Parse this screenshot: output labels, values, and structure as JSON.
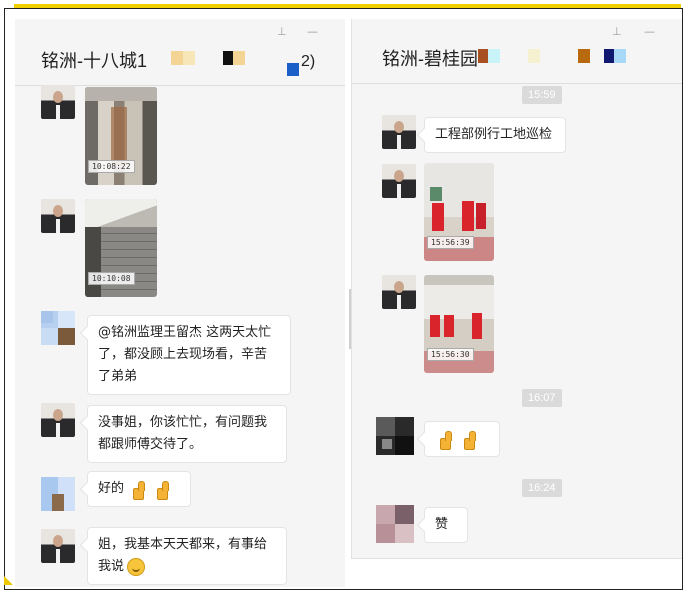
{
  "left_chat": {
    "title": "铭洲-十八城1",
    "title_tail": "2)",
    "messages": [
      {
        "type": "image",
        "timestamp": "10:08:22"
      },
      {
        "type": "image",
        "timestamp": "10:10:08"
      },
      {
        "type": "text",
        "line1": "@铭洲监理王留杰 这两天太忙",
        "line2": "了，都没顾上去现场看，辛苦",
        "line3": "了弟弟"
      },
      {
        "type": "text",
        "line1": "没事姐，你该忙忙，有问题我",
        "line2": "都跟师傅交待了。"
      },
      {
        "type": "text",
        "text": "好的",
        "emoji": [
          "thumbs-up",
          "thumbs-up"
        ]
      },
      {
        "type": "text",
        "line1": "姐，我基本天天都来，有事给",
        "line2": "我说",
        "emoji": "smile"
      }
    ]
  },
  "right_chat": {
    "title": "铭洲-碧桂园",
    "times": [
      "15:59",
      "16:07",
      "16:24"
    ],
    "messages": [
      {
        "type": "text",
        "text": "工程部例行工地巡检"
      },
      {
        "type": "image",
        "timestamp": "15:56:39"
      },
      {
        "type": "image",
        "timestamp": "15:56:30"
      },
      {
        "type": "emoji",
        "emoji": [
          "thumbs-up",
          "thumbs-up"
        ]
      },
      {
        "type": "text",
        "text": "赞"
      }
    ]
  },
  "window_controls": {
    "pin": "⊥",
    "minimize": "—"
  },
  "colors": {
    "accent_bar": "#f0d000",
    "pane_bg": "#f5f5f5",
    "time_pill": "#dadada"
  }
}
